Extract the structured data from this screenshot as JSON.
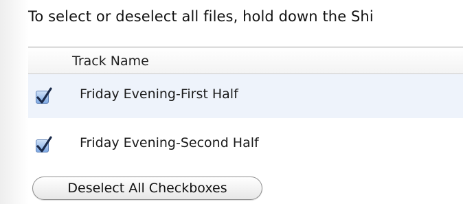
{
  "instruction_text": "To select or deselect all files, hold down the Shi",
  "table": {
    "column_header": "Track Name",
    "rows": [
      {
        "label": "Friday Evening-First Half",
        "checked": true
      },
      {
        "label": "Friday Evening-Second Half",
        "checked": true
      }
    ]
  },
  "deselect_button_label": "Deselect All Checkboxes",
  "colors": {
    "selected_row_bg": "#eef3fb",
    "checkbox_fill": "#7fa9e3",
    "checkmark": "#1a2a4a"
  },
  "icons": {
    "checkbox": "checkbox-checked-icon"
  }
}
